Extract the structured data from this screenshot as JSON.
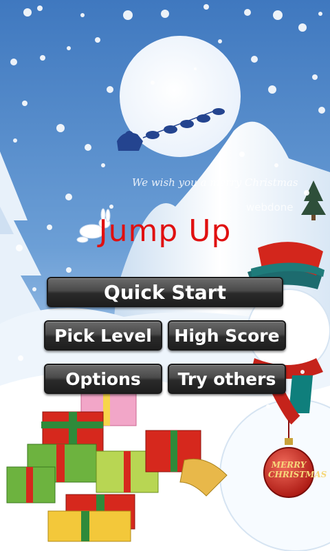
{
  "app": {
    "title": "Jump Up",
    "greeting": "We wish you a merry Christmas",
    "watermark": "webdone",
    "ornament_text": "MERRY CHRISTMAS"
  },
  "menu": {
    "quick_start": "Quick Start",
    "pick_level": "Pick Level",
    "high_score": "High Score",
    "options": "Options",
    "try_others": "Try others"
  },
  "colors": {
    "title": "#e01010",
    "sky": "#4f86c6",
    "button": "#3a3a3a"
  }
}
